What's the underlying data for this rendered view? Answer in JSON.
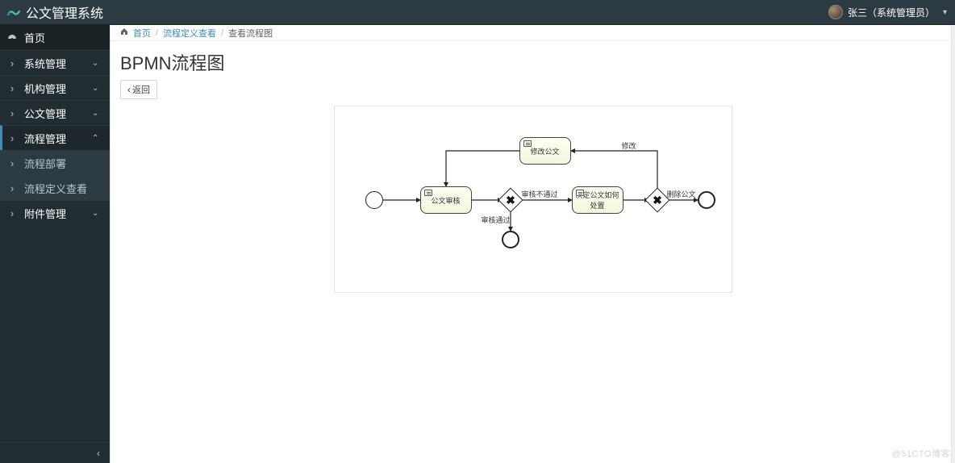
{
  "app": {
    "title": "公文管理系统"
  },
  "user": {
    "display": "张三（系统管理员）"
  },
  "sidebar": {
    "items": [
      {
        "label": "首页"
      },
      {
        "label": "系统管理"
      },
      {
        "label": "机构管理"
      },
      {
        "label": "公文管理"
      },
      {
        "label": "流程管理"
      },
      {
        "label": "流程部署"
      },
      {
        "label": "流程定义查看"
      },
      {
        "label": "附件管理"
      }
    ]
  },
  "breadcrumb": {
    "home": "首页",
    "level1": "流程定义查看",
    "level2": "查看流程图"
  },
  "page": {
    "title": "BPMN流程图",
    "back_label": "返回"
  },
  "bpmn": {
    "tasks": {
      "review": "公文审核",
      "modify": "修改公文",
      "decide": "决定公文如何处置"
    },
    "labels": {
      "fail": "审核不通过",
      "pass": "审核通过",
      "modify": "修改",
      "delete": "删除公文"
    }
  },
  "watermark": "@51CTO博客"
}
